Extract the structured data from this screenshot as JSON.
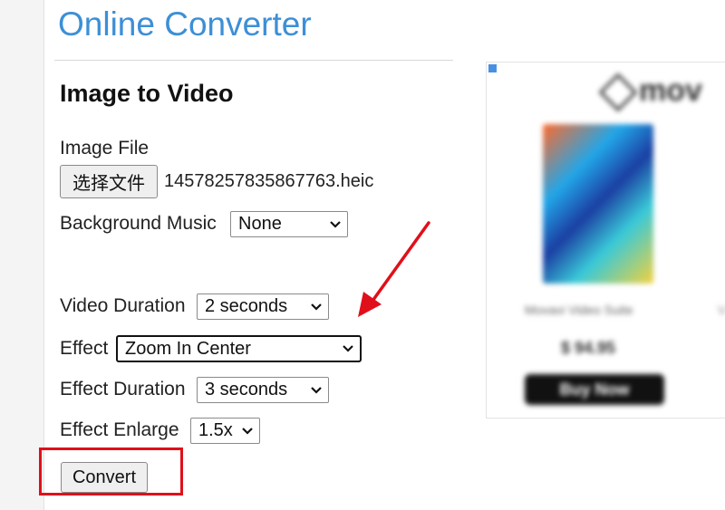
{
  "site": {
    "title": "Online Converter"
  },
  "form": {
    "heading": "Image to Video",
    "image_file_label": "Image File",
    "choose_file_button": "选择文件",
    "file_name": "14578257835867763.heic",
    "background_music_label": "Background Music",
    "background_music_value": "None",
    "video_duration_label": "Video Duration",
    "video_duration_value": "2 seconds",
    "effect_label": "Effect",
    "effect_value": "Zoom In Center",
    "effect_duration_label": "Effect Duration",
    "effect_duration_value": "3 seconds",
    "effect_enlarge_label": "Effect Enlarge",
    "effect_enlarge_value": "1.5x",
    "convert_button": "Convert"
  },
  "ad": {
    "brand": "mov",
    "product_name": "Movavi Video Suite",
    "price": "$ 94.95",
    "buy_button": "Buy Now",
    "next_item_text": "V"
  },
  "annotations": {
    "highlight_color": "#e0101a",
    "arrow_color": "#e0101a"
  },
  "colors": {
    "title_blue": "#3d8fd6"
  }
}
